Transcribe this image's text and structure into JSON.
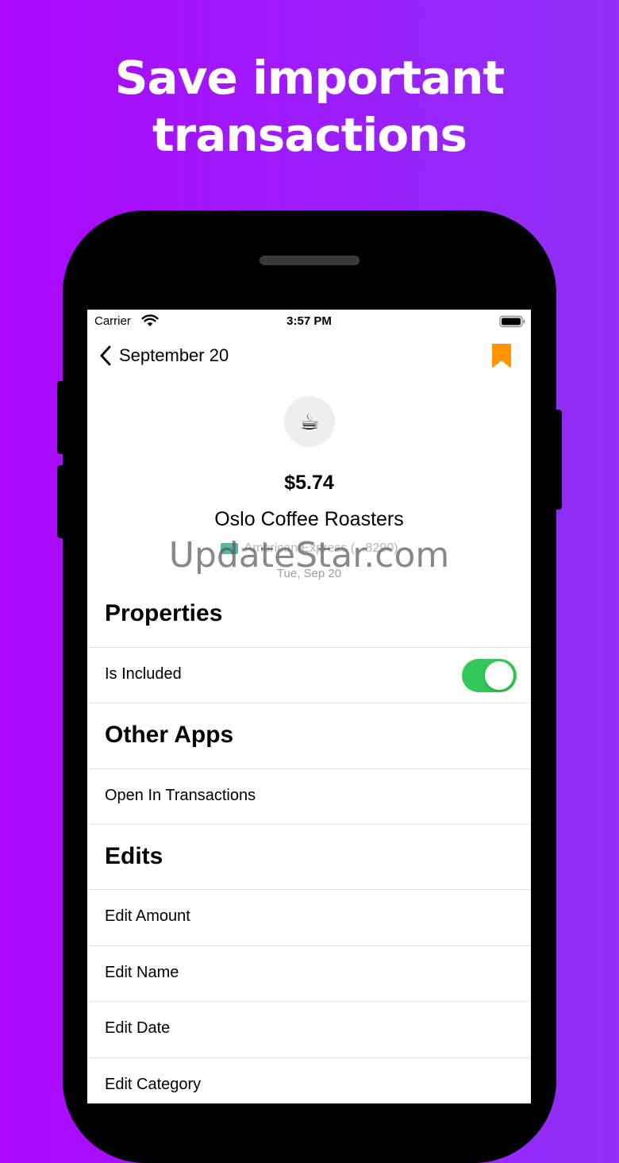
{
  "headline": {
    "line1": "Save important",
    "line2": "transactions"
  },
  "status_bar": {
    "carrier": "Carrier",
    "time": "3:57 PM",
    "wifi_icon": "wifi-icon",
    "battery_icon": "battery-full-icon"
  },
  "nav": {
    "back_icon": "chevron-left-icon",
    "back_label": "September 20",
    "bookmark_icon": "bookmark-icon",
    "bookmark_color": "#ff9500"
  },
  "transaction": {
    "emoji": "☕",
    "amount": "$5.74",
    "merchant": "Oslo Coffee Roasters",
    "account": "American Express (...8290)",
    "date": "Tue, Sep 20"
  },
  "watermark": "UpdateStar.com",
  "sections": {
    "properties": {
      "title": "Properties",
      "rows": [
        {
          "label": "Is Included",
          "toggle_on": true,
          "toggle_color": "#34c759"
        }
      ]
    },
    "other_apps": {
      "title": "Other Apps",
      "rows": [
        {
          "label": "Open In Transactions"
        }
      ]
    },
    "edits": {
      "title": "Edits",
      "rows": [
        {
          "label": "Edit Amount"
        },
        {
          "label": "Edit Name"
        },
        {
          "label": "Edit Date"
        },
        {
          "label": "Edit Category"
        }
      ]
    }
  }
}
